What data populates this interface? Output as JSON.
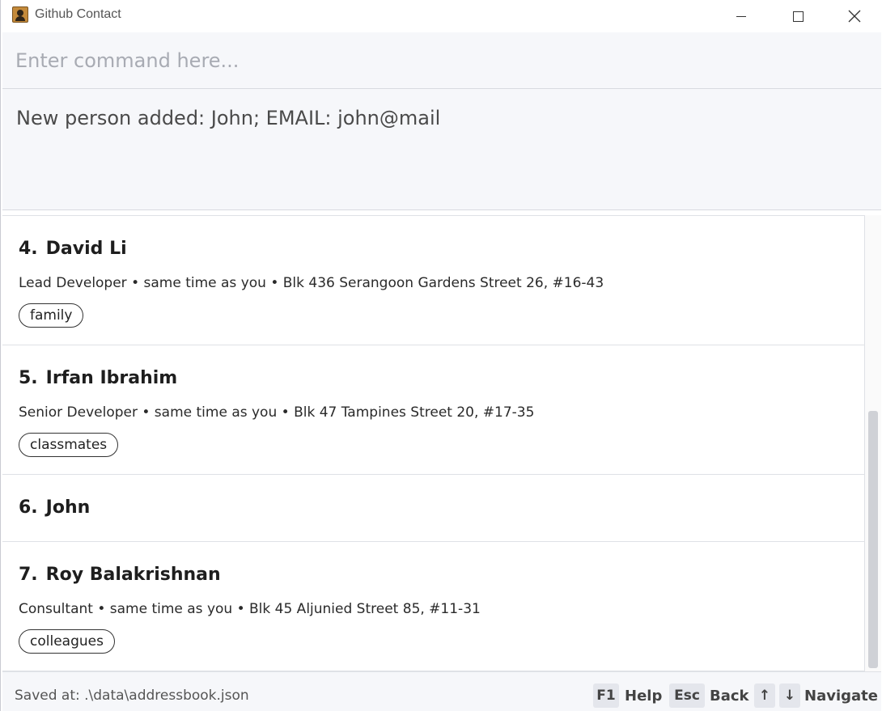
{
  "window": {
    "title": "Github Contact"
  },
  "command": {
    "placeholder": "Enter command here...",
    "value": ""
  },
  "result": {
    "message": "New person added: John; EMAIL: john@mail"
  },
  "persons": [
    {
      "index": "4.",
      "name": "David Li",
      "details": "Lead Developer • same time as you • Blk 436 Serangoon Gardens Street 26, #16-43",
      "tag": "family"
    },
    {
      "index": "5.",
      "name": "Irfan Ibrahim",
      "details": "Senior Developer • same time as you • Blk 47 Tampines Street 20, #17-35",
      "tag": "classmates"
    },
    {
      "index": "6.",
      "name": "John",
      "details": "",
      "tag": ""
    },
    {
      "index": "7.",
      "name": "Roy Balakrishnan",
      "details": "Consultant • same time as you • Blk 45 Aljunied Street 85, #11-31",
      "tag": "colleagues"
    }
  ],
  "status": {
    "saved_at": "Saved at: .\\data\\addressbook.json",
    "help_key": "F1",
    "help_label": "Help",
    "back_key": "Esc",
    "back_label": "Back",
    "up_key": "↑",
    "down_key": "↓",
    "navigate_label": "Navigate"
  },
  "icons": {
    "app": "contact-book-icon",
    "minimize": "minimize-icon",
    "maximize": "maximize-icon",
    "close": "close-icon"
  }
}
